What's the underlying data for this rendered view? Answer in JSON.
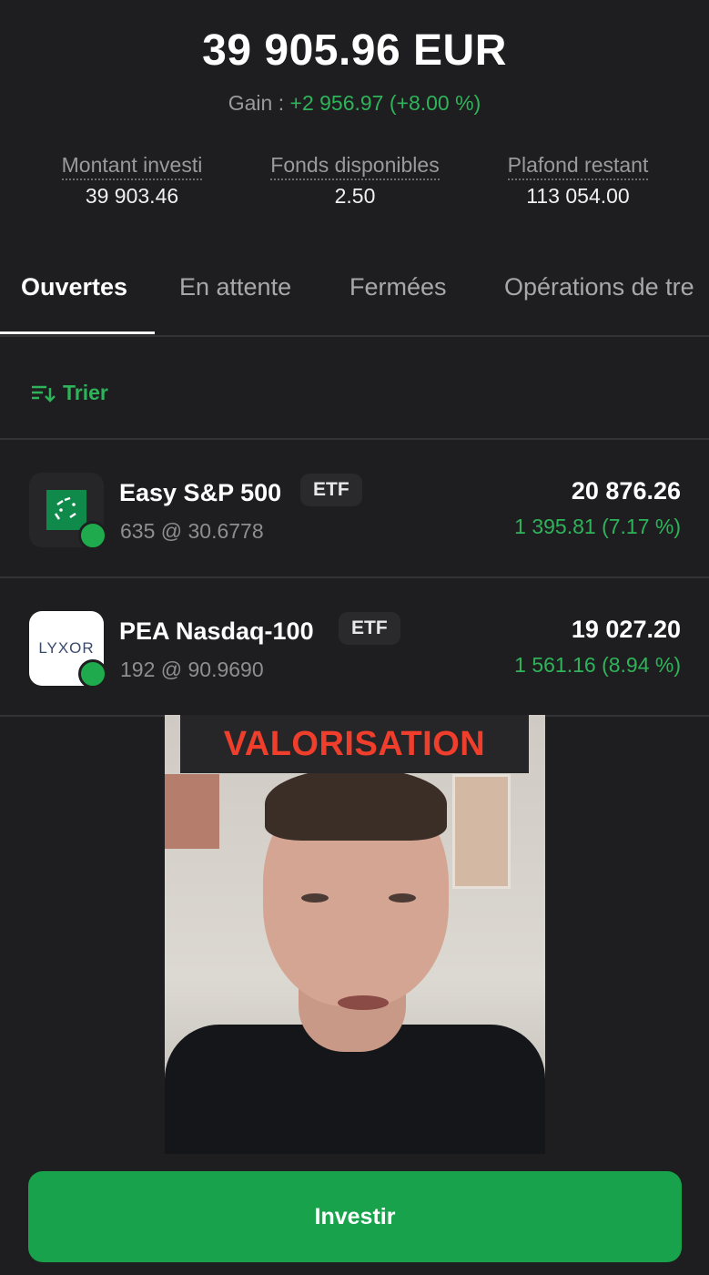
{
  "portfolio": {
    "total_value": "39 905.96 EUR",
    "gain_label": "Gain :",
    "gain_value": "+2 956.97 (+8.00 %)"
  },
  "stats": [
    {
      "label": "Montant investi",
      "value": "39 903.46"
    },
    {
      "label": "Fonds disponibles",
      "value": "2.50"
    },
    {
      "label": "Plafond restant",
      "value": "113 054.00"
    }
  ],
  "tabs": [
    {
      "label": "Ouvertes",
      "active": true
    },
    {
      "label": "En attente",
      "active": false
    },
    {
      "label": "Fermées",
      "active": false
    },
    {
      "label": "Opérations de tre",
      "active": false
    }
  ],
  "sort": {
    "label": "Trier",
    "icon": "sort-icon"
  },
  "positions": [
    {
      "name": "Easy S&P 500",
      "type": "ETF",
      "quantity": "635 @ 30.6778",
      "amount": "20 876.26",
      "performance": "1 395.81 (7.17 %)",
      "logo": "bnp-paribas-logo"
    },
    {
      "name": "PEA Nasdaq-100",
      "type": "ETF",
      "quantity": "192 @ 90.9690",
      "amount": "19 027.20",
      "performance": "1 561.16 (8.94 %)",
      "logo_text": "LYXOR"
    }
  ],
  "overlay": {
    "banner": "VALORISATION"
  },
  "cta": {
    "label": "Investir"
  },
  "colors": {
    "background": "#1e1e20",
    "accent_green": "#17a24b",
    "gain_green": "#2fb35a",
    "banner_red": "#ef3f2c"
  }
}
